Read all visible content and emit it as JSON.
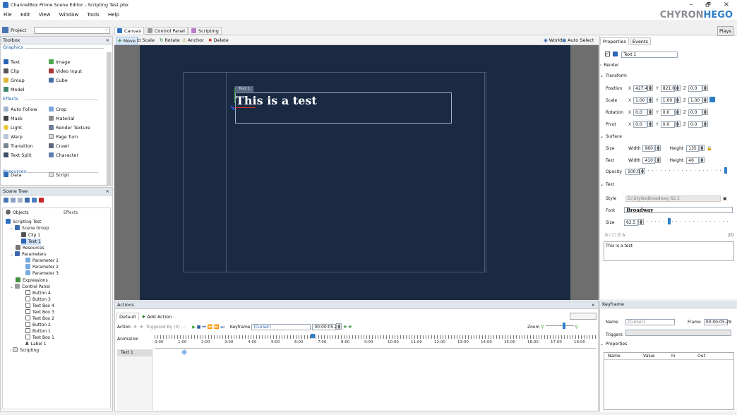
{
  "window": {
    "title": "ChannelBox Prime Scene Editor - Scripting Test.pbx",
    "min_glyph": "–",
    "max_glyph": "🗗",
    "close_glyph": "×",
    "logo_a": "CHYRON",
    "logo_b": "HEGO"
  },
  "menu": [
    "File",
    "Edit",
    "View",
    "Window",
    "Tools",
    "Help"
  ],
  "toolbar": {
    "project_label": "Project",
    "project_value": "",
    "tabs": [
      "Canvas",
      "Control Panel",
      "Scripting"
    ],
    "tools": [
      "Move",
      "Scale",
      "Rotate",
      "Anchor",
      "Delete"
    ],
    "world": "World",
    "auto_select": "Auto Select",
    "play": "Plays"
  },
  "toolbox": {
    "title": "Toolbox",
    "graphics": "Graphics",
    "graphics_items": [
      "Text",
      "Image",
      "Clip",
      "Video Input",
      "Group",
      "Cube",
      "Model"
    ],
    "effects": "Effects",
    "effects_items": [
      "Auto Follow",
      "Crop",
      "Mask",
      "Material",
      "Light",
      "Render Texture",
      "Warp",
      "Page Turn",
      "Transition",
      "Crawl",
      "Text Split",
      "Character"
    ],
    "resources": "Resources",
    "resources_items": [
      "Data",
      "Script"
    ]
  },
  "scene_tree": {
    "title": "Scene Tree",
    "col_objects": "Objects",
    "col_effects": "Effects",
    "items": [
      "Scripting Test",
      "Scene Group",
      "Clip 1",
      "Text 1",
      "Resources",
      "Parameters",
      "Parameter 1",
      "Parameter 2",
      "Parameter 3",
      "Expressions",
      "Control Panel",
      "Button 4",
      "Button 3",
      "Text Box 4",
      "Text Box 3",
      "Text Box 2",
      "Button 2",
      "Button 1",
      "Text Box 1",
      "Label 1",
      "Scripting"
    ]
  },
  "canvas": {
    "text": "This is a test",
    "tag": "Text 1"
  },
  "actions": {
    "title": "Actions",
    "tab_default": "Default",
    "add_action": "Add Action",
    "action_label": "Action",
    "triggered_by": "Triggered By (0) ...",
    "keyframe_label": "Keyframe",
    "keyframe_value": "(Cursor)",
    "time_value": "00:00:05.29",
    "zoom_label": "Zoom",
    "animation_label": "Animation",
    "track": "Text 1",
    "ticks": [
      "0:00",
      "1:00",
      "2:00",
      "3:00",
      "4:00",
      "5:00",
      "6:00",
      "7:00",
      "8:00",
      "9:00",
      "10:00",
      "11:00",
      "12:00",
      "13:00",
      "14:00",
      "15:00",
      "16:00",
      "17:00",
      "18:00"
    ]
  },
  "properties": {
    "tab_properties": "Properties",
    "tab_events": "Events",
    "name_value": "Text 1",
    "render": "Render",
    "transform": "Transform",
    "position": {
      "label": "Position",
      "x": "427.4",
      "y": "821.6",
      "z": "0.0"
    },
    "scale": {
      "label": "Scale",
      "x": "1.00",
      "y": "1.00",
      "z": "1.00"
    },
    "rotation": {
      "label": "Rotation",
      "x": "0.0",
      "y": "0.0",
      "z": "0.0"
    },
    "pivot": {
      "label": "Pivot",
      "x": "0.0",
      "y": "0.0",
      "z": "0.0"
    },
    "surface": "Surface",
    "size_label": "Size",
    "width_label": "Width",
    "height_label": "Height",
    "size_w": "960",
    "size_h": "135",
    "text_label": "Text",
    "text_w": "410",
    "text_h": "46",
    "opacity_label": "Opacity",
    "opacity": "100.0",
    "text_section": "Text",
    "style_label": "Style",
    "style_value": "D:\\Styles\\Broadway 62.5",
    "font_label": "Font",
    "font_value": "Broadway",
    "fsize_label": "Size",
    "fsize_value": "62.5",
    "format_2d": "2D",
    "text_content": "This is a test"
  },
  "keyframe": {
    "title": "Keyframe",
    "name_label": "Name",
    "name_value": "(Cursor)",
    "frame_label": "Frame",
    "frame_value": "00:00:05.29",
    "triggers_label": "Triggers",
    "properties_label": "Properties",
    "columns": [
      "Name",
      "Value",
      "In",
      "Out"
    ]
  },
  "colors": {
    "canvas_bg": "#1a2a43",
    "accent": "#1a5ea8",
    "logo_blue": "#2e7fc8",
    "logo_gray": "#8a8d92"
  }
}
